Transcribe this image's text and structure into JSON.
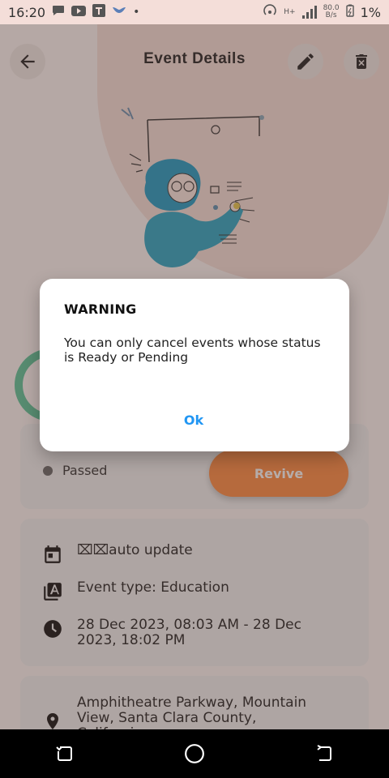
{
  "status_bar": {
    "time": "16:20",
    "speed_value": "80.0",
    "speed_unit": "B/s",
    "battery": "1%",
    "network_label": "H+"
  },
  "header": {
    "title": "Event Details"
  },
  "status_card": {
    "status_text": "Passed",
    "revive_label": "Revive"
  },
  "info_card": {
    "name": "⌧⌧auto update",
    "event_type": "Event type: Education",
    "date_range": "28 Dec 2023, 08:03 AM - 28 Dec 2023, 18:02 PM"
  },
  "location_card": {
    "address": "Amphitheatre Parkway, Mountain View, Santa Clara County, California,"
  },
  "dialog": {
    "title": "WARNING",
    "message": "You can only cancel events whose status is Ready or Pending",
    "ok_label": "Ok"
  },
  "colors": {
    "accent": "#ff8c42",
    "dialog_button": "#2196f3",
    "ring": "#5cc59a"
  }
}
